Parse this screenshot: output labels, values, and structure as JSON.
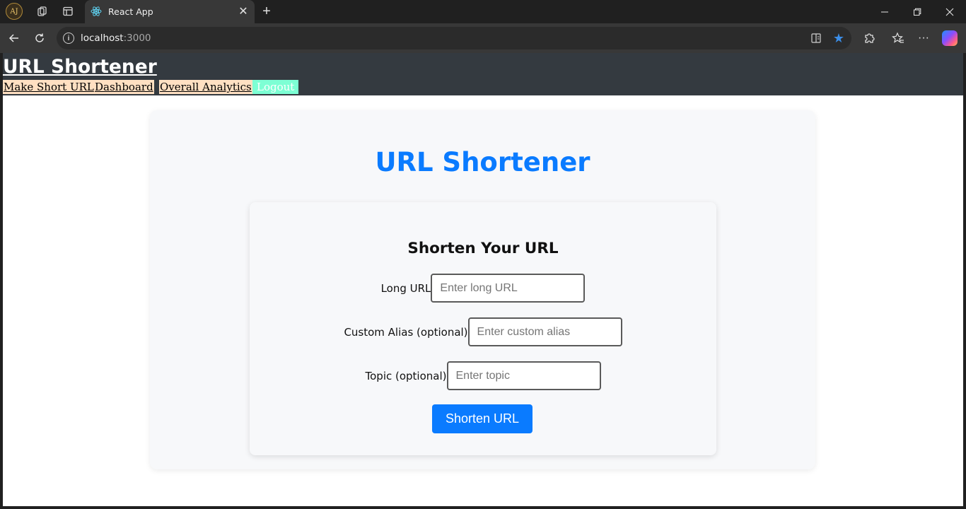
{
  "browser": {
    "tab_title": "React App",
    "url_host": "localhost",
    "url_port": ":3000",
    "profile_initials": "AJ",
    "icons": [
      "workspaces-icon",
      "tab-actions-icon",
      "react-favicon",
      "close-icon",
      "new-tab-icon",
      "back-icon",
      "refresh-icon",
      "site-info-icon",
      "immersive-reader-icon",
      "favorite-star-icon",
      "extensions-icon",
      "favorites-icon",
      "more-icon",
      "copilot-icon"
    ],
    "accent_colors": {
      "favorite_star": "#3b8ee8"
    }
  },
  "app": {
    "title": "URL Shortener",
    "nav": {
      "make_short_url": "Make Short URL",
      "dashboard": "Dashboard",
      "overall_analytics": "Overall Analytics",
      "logout": "Logout"
    },
    "colors": {
      "header_bg": "#343a40",
      "nav_link_bg": "#ffe0c2",
      "logout_bg": "#7dffd4",
      "primary": "#0a7bff"
    }
  },
  "main": {
    "heading": "URL Shortener",
    "form": {
      "heading": "Shorten Your URL",
      "long_url": {
        "label": "Long URL",
        "placeholder": "Enter long URL",
        "value": ""
      },
      "alias": {
        "label": "Custom Alias (optional)",
        "placeholder": "Enter custom alias",
        "value": ""
      },
      "topic": {
        "label": "Topic (optional)",
        "placeholder": "Enter topic",
        "value": ""
      },
      "submit_label": "Shorten URL"
    }
  }
}
